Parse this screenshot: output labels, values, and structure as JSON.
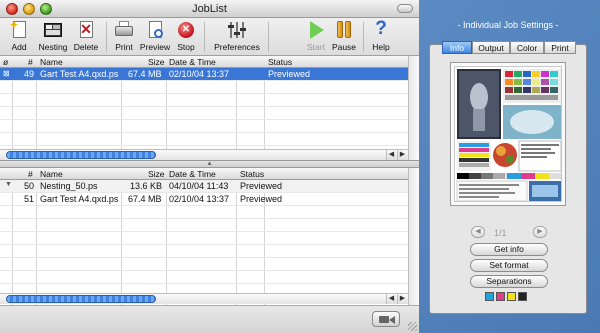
{
  "window": {
    "title": "JobList"
  },
  "toolbar": {
    "add": "Add",
    "nesting": "Nesting",
    "delete": "Delete",
    "print": "Print",
    "preview": "Preview",
    "stop": "Stop",
    "preferences": "Preferences",
    "start": "Start",
    "pause": "Pause",
    "help": "Help"
  },
  "columns": {
    "flag": "ø",
    "num": "#",
    "name": "Name",
    "size": "Size",
    "date": "Date & Time",
    "status": "Status"
  },
  "top_jobs": [
    {
      "num": "49",
      "name": "Gart Test A4.qxd.ps",
      "size": "67.4 MB",
      "date": "02/10/04 13:37",
      "status": "Previewed"
    }
  ],
  "bottom_jobs": [
    {
      "num": "50",
      "name": "Nesting_50.ps",
      "size": "13.6 KB",
      "date": "04/10/04 11:43",
      "status": "Previewed"
    },
    {
      "num": "51",
      "name": "Gart Test A4.qxd.ps",
      "size": "67.4 MB",
      "date": "02/10/04 13:37",
      "status": "Previewed"
    }
  ],
  "panel": {
    "title": "- Individual Job Settings -",
    "tabs": [
      "Info",
      "Output",
      "Color",
      "Print"
    ],
    "active_tab": "Info",
    "page_indicator": "1/1",
    "buttons": {
      "get_info": "Get info",
      "set_format": "Set format",
      "separations": "Separations"
    },
    "separation_colors": [
      "#1fa3dc",
      "#e23a8c",
      "#f2e21a",
      "#222222"
    ]
  }
}
